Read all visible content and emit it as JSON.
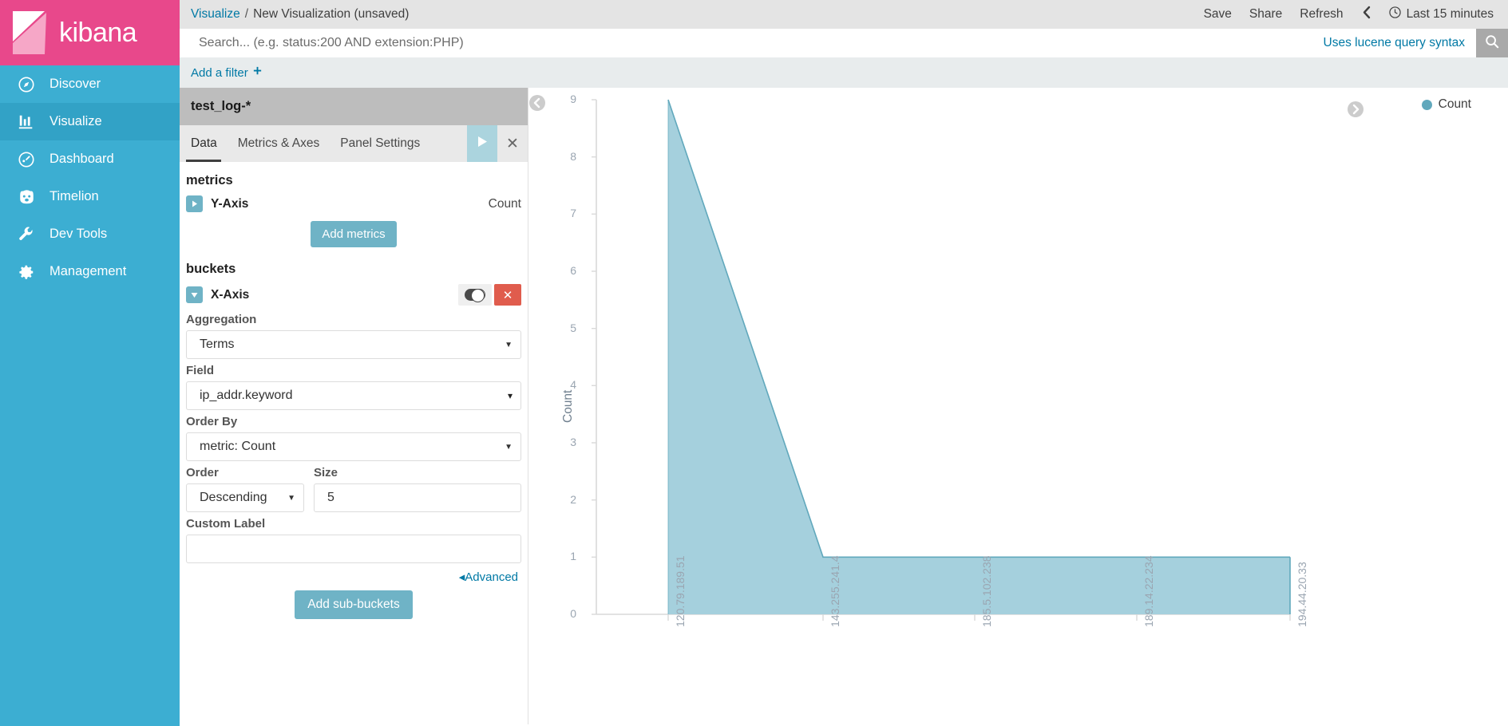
{
  "brand": {
    "name": "kibana"
  },
  "sidebar": {
    "items": [
      {
        "label": "Discover",
        "icon": "compass-icon",
        "active": false
      },
      {
        "label": "Visualize",
        "icon": "bar-chart-icon",
        "active": true
      },
      {
        "label": "Dashboard",
        "icon": "dashboard-icon",
        "active": false
      },
      {
        "label": "Timelion",
        "icon": "timelion-icon",
        "active": false
      },
      {
        "label": "Dev Tools",
        "icon": "wrench-icon",
        "active": false
      },
      {
        "label": "Management",
        "icon": "gear-icon",
        "active": false
      }
    ]
  },
  "topbar": {
    "breadcrumb_root": "Visualize",
    "breadcrumb_sep": "/",
    "breadcrumb_current": "New Visualization (unsaved)",
    "save_label": "Save",
    "share_label": "Share",
    "refresh_label": "Refresh",
    "time_range": "Last 15 minutes",
    "back_icon": "chevron-left-icon",
    "clock_icon": "clock-icon"
  },
  "query": {
    "value": "",
    "placeholder": "Search... (e.g. status:200 AND extension:PHP)",
    "lucene_hint": "Uses lucene query syntax",
    "search_icon": "search-icon"
  },
  "filters": {
    "add_label": "Add a filter",
    "plus_icon": "plus-icon"
  },
  "editor": {
    "index_pattern": "test_log-*",
    "tabs": [
      {
        "label": "Data",
        "active": true
      },
      {
        "label": "Metrics & Axes",
        "active": false
      },
      {
        "label": "Panel Settings",
        "active": false
      }
    ],
    "apply_icon": "play-icon",
    "discard_icon": "close-icon",
    "metrics_heading": "metrics",
    "y_axis_label": "Y-Axis",
    "y_axis_value": "Count",
    "add_metrics_label": "Add metrics",
    "buckets_heading": "buckets",
    "x_axis_label": "X-Axis",
    "toggle_icon": "toggle-icon",
    "remove_icon": "remove-icon",
    "aggregation_label": "Aggregation",
    "aggregation_value": "Terms",
    "field_label": "Field",
    "field_value": "ip_addr.keyword",
    "order_by_label": "Order By",
    "order_by_value": "metric: Count",
    "order_label": "Order",
    "order_value": "Descending",
    "size_label": "Size",
    "size_value": "5",
    "custom_label_label": "Custom Label",
    "custom_label_value": "",
    "advanced_label": "Advanced",
    "add_sub_buckets_label": "Add sub-buckets"
  },
  "vis": {
    "collapse_left_icon": "chevron-left-circle-icon",
    "collapse_right_icon": "chevron-right-circle-icon",
    "legend_label": "Count",
    "legend_color": "#61a8bc"
  },
  "chart_data": {
    "type": "area",
    "title": "",
    "xlabel": "",
    "ylabel": "Count",
    "categories": [
      "120.79.189.51",
      "143.255.241.4",
      "185.5.102.238",
      "189.14.22.234",
      "194.44.20.33"
    ],
    "series": [
      {
        "name": "Count",
        "values": [
          9,
          1,
          1,
          1,
          1
        ],
        "color": "#a5d0dd",
        "line_color": "#61a8bc"
      }
    ],
    "ylim": [
      0,
      9
    ],
    "yticks": [
      0,
      1,
      2,
      3,
      4,
      5,
      6,
      7,
      8,
      9
    ],
    "grid": false,
    "legend_position": "top-right"
  }
}
